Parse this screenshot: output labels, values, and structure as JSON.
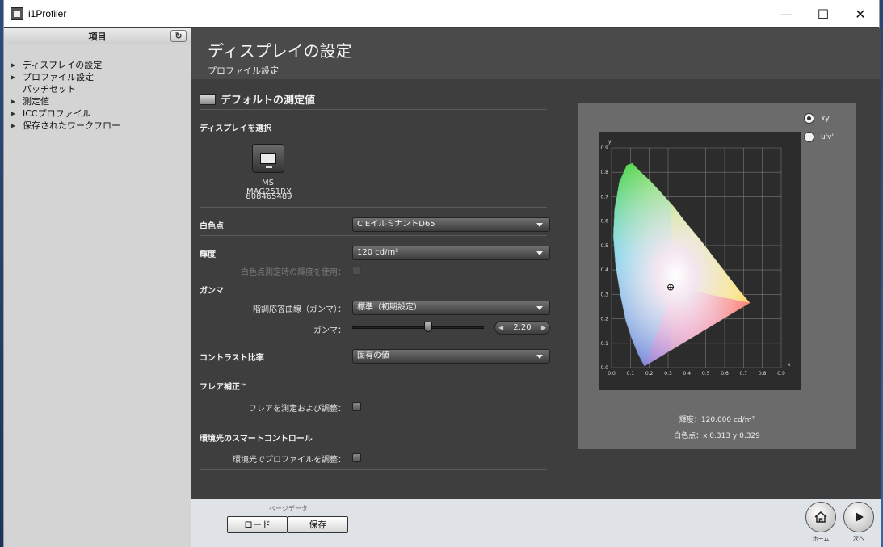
{
  "window": {
    "title": "i1Profiler"
  },
  "sidebar": {
    "header": "項目",
    "items": [
      {
        "label": "ディスプレイの設定",
        "arrow": true
      },
      {
        "label": "プロファイル設定",
        "arrow": true
      },
      {
        "label": "パッチセット",
        "arrow": false
      },
      {
        "label": "測定値",
        "arrow": true
      },
      {
        "label": "ICCプロファイル",
        "arrow": true
      },
      {
        "label": "保存されたワークフロー",
        "arrow": true
      }
    ]
  },
  "header": {
    "title": "ディスプレイの設定",
    "subtitle": "プロファイル設定"
  },
  "section": {
    "title": "デフォルトの測定値"
  },
  "display": {
    "label": "ディスプレイを選択",
    "name": "MSI MAG251RX",
    "serial": "808465489"
  },
  "whitepoint": {
    "label": "白色点",
    "value": "CIEイルミナントD65"
  },
  "luminance": {
    "label": "輝度",
    "value": "120 cd/m²",
    "use_measured_label": "白色点測定時の輝度を使用："
  },
  "gamma": {
    "label": "ガンマ",
    "curve_label": "階調応答曲線（ガンマ）：",
    "curve_value": "標準（初期設定）",
    "slider_label": "ガンマ：",
    "value": "2.20",
    "slider_fraction": 0.58
  },
  "contrast": {
    "label": "コントラスト比率",
    "value": "固有の値"
  },
  "flare": {
    "label": "フレア補正™",
    "check_label": "フレアを測定および調整："
  },
  "ambient": {
    "label": "環境光のスマートコントロール",
    "check_label": "環境光でプロファイルを調整："
  },
  "chart_panel": {
    "radio_xy": "xy",
    "radio_uv": "u'v'",
    "luminance_text": "輝度：120.000 cd/m²",
    "whitepoint_text": "白色点：x 0.313  y 0.329"
  },
  "chart_data": {
    "type": "scatter",
    "title": "",
    "xlabel": "x",
    "ylabel": "y",
    "xlim": [
      0.0,
      0.9
    ],
    "ylim": [
      0.0,
      0.9
    ],
    "x_ticks": [
      "0.0",
      "0.1",
      "0.2",
      "0.3",
      "0.4",
      "0.5",
      "0.6",
      "0.7",
      "0.8",
      "0.9"
    ],
    "y_ticks": [
      "0.0",
      "0.1",
      "0.2",
      "0.3",
      "0.4",
      "0.5",
      "0.6",
      "0.7",
      "0.8",
      "0.9"
    ],
    "grid": true,
    "series": [
      {
        "values": [
          {
            "x": 0.313,
            "y": 0.329
          }
        ]
      }
    ]
  },
  "footer": {
    "page_data_label": "ページデータ",
    "load_label": "ロード",
    "save_label": "保存",
    "home_label": "ホーム",
    "next_label": "次へ"
  }
}
